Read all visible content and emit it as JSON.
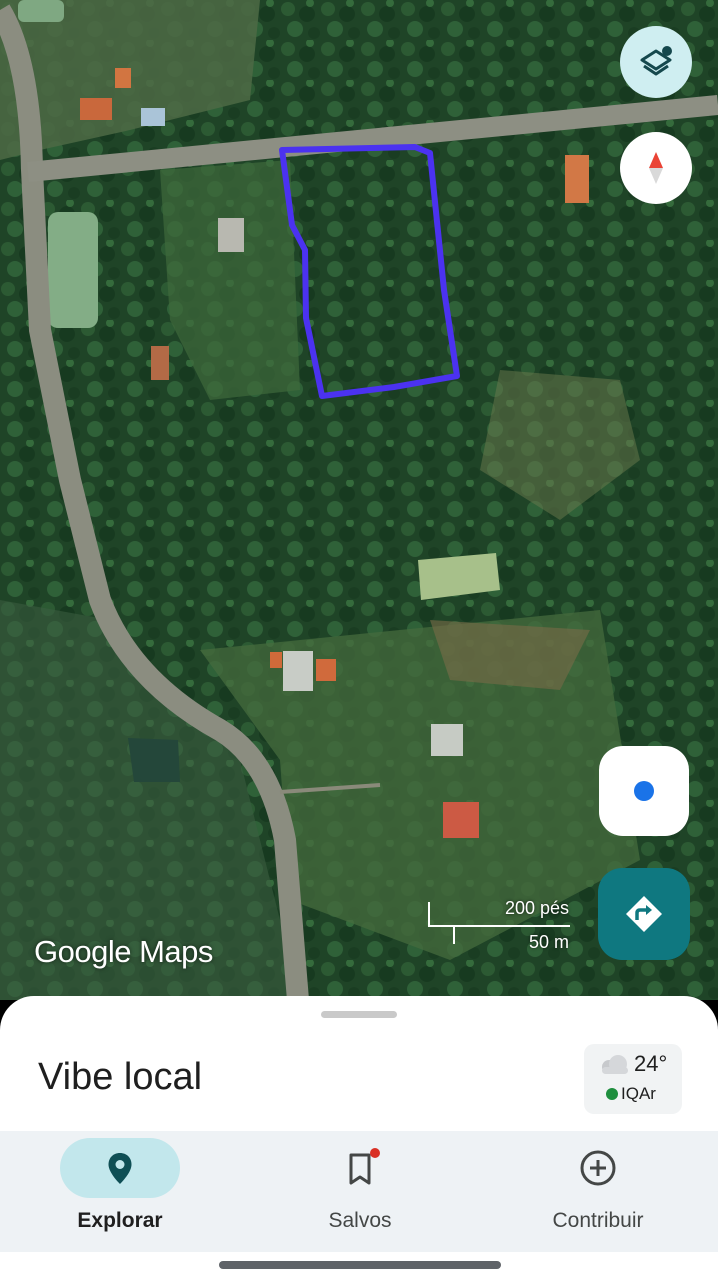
{
  "map": {
    "watermark": "Google Maps",
    "scale_imperial": "200 pés",
    "scale_metric": "50 m"
  },
  "controls": {
    "layers_icon": "layers-icon",
    "compass_icon": "compass-icon",
    "location_icon": "my-location-icon",
    "directions_icon": "directions-icon"
  },
  "sheet": {
    "title": "Vibe local",
    "weather": {
      "temperature": "24°",
      "air_quality": "IQAr",
      "icon": "cloud-icon",
      "aq_color": "#1e8e3e"
    }
  },
  "nav": {
    "items": [
      {
        "label": "Explorar",
        "icon": "location-pin-icon",
        "active": true
      },
      {
        "label": "Salvos",
        "icon": "bookmark-icon",
        "badge": true
      },
      {
        "label": "Contribuir",
        "icon": "add-circle-icon"
      }
    ]
  },
  "colors": {
    "accent": "#0f7880",
    "polygon": "#4b32f0",
    "active_pill": "#c2e7ec"
  }
}
